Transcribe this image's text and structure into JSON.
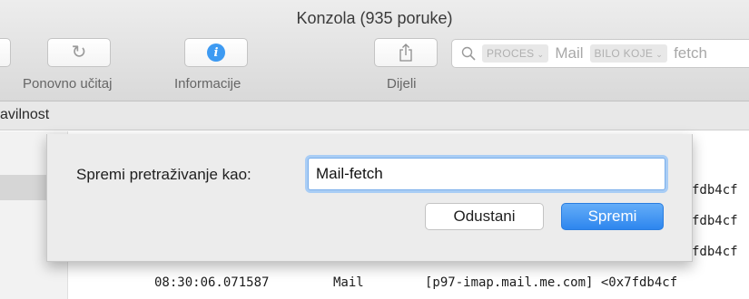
{
  "window": {
    "title": "Konzola (935 poruke)"
  },
  "toolbar": {
    "reload_label": "Ponovno učitaj",
    "info_label": "Informacije",
    "share_label": "Dijeli",
    "search": {
      "process_token": "PROCES",
      "process_value": "Mail",
      "any_token": "BILO KOJE",
      "any_value": "fetch"
    }
  },
  "subbar": {
    "text": "avilnost"
  },
  "dialog": {
    "label": "Spremi pretraživanje kao:",
    "input_value": "Mail-fetch",
    "cancel_label": "Odustani",
    "save_label": "Spremi"
  },
  "log": {
    "fragments": [
      "fdb4cf",
      "fdb4cf",
      "fdb4cf"
    ],
    "row": {
      "time": "08:30:06.071587",
      "process": "Mail",
      "message": "[p97-imap.mail.me.com] <0x7fdb4cf"
    }
  },
  "colors": {
    "accent": "#3d9af2",
    "save_button": "#2d86ee",
    "focus_ring": "#a9cdf5"
  }
}
